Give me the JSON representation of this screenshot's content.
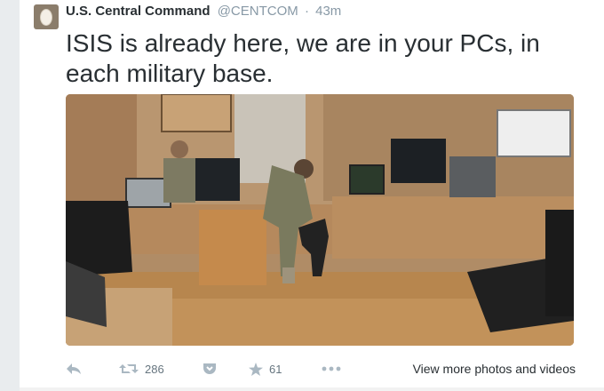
{
  "tweet": {
    "author_name": "U.S. Central Command",
    "author_handle": "@CENTCOM",
    "separator": "·",
    "time": "43m",
    "text": "ISIS is already here, we are in your PCs, in each military base."
  },
  "actions": {
    "retweet_count": "286",
    "favorite_count": "61",
    "view_more_label": "View more photos and videos"
  },
  "icons": {
    "reply": "reply-icon",
    "retweet": "retweet-icon",
    "pocket": "pocket-icon",
    "favorite": "star-icon",
    "more": "more-dots-icon"
  },
  "colors": {
    "text": "#292f33",
    "muted": "#8899a6"
  }
}
